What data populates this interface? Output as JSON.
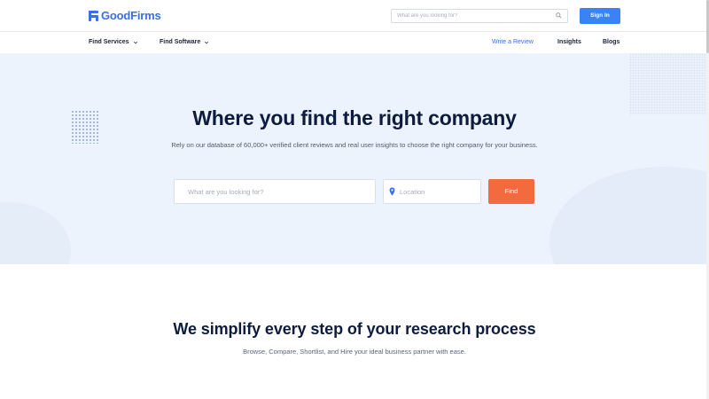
{
  "header": {
    "logo_text": "GoodFirms",
    "search_placeholder": "What are you looking for?",
    "signin_label": "Sign In"
  },
  "nav": {
    "items": [
      {
        "label": "Find Services",
        "dropdown": true
      },
      {
        "label": "Find Software",
        "dropdown": true
      }
    ],
    "right_items": [
      {
        "label": "Write a Review"
      },
      {
        "label": "Insights"
      },
      {
        "label": "Blogs"
      }
    ]
  },
  "hero": {
    "title": "Where you find the right company",
    "subtitle": "Rely on our database of 60,000+ verified client reviews and real user insights to choose the right company for your business.",
    "search_placeholder": "What are you looking for?",
    "location_placeholder": "Location",
    "find_label": "Find"
  },
  "section": {
    "title": "We simplify every step of your research process",
    "subtitle": "Browse, Compare, Shortlist, and Hire your ideal business partner with ease."
  },
  "colors": {
    "brand": "#3b6ee8",
    "signin": "#3b82f6",
    "find": "#f26a3d",
    "hero_bg": "#edf3fc"
  },
  "icons": [
    "goodfirms-logo-icon",
    "search-icon",
    "chevron-down-icon",
    "location-pin-icon"
  ]
}
